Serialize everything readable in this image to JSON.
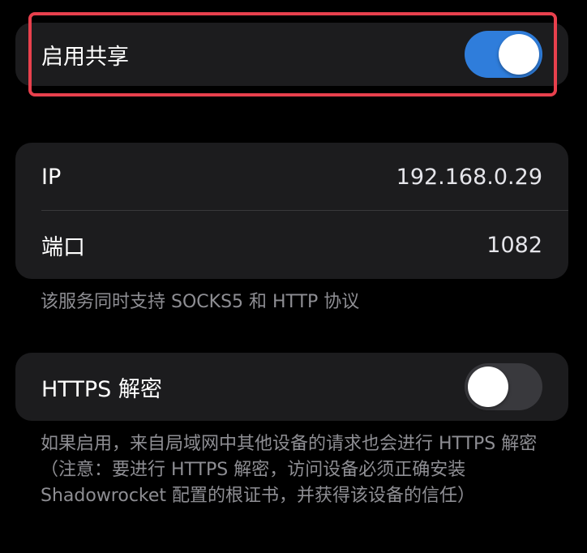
{
  "share": {
    "label": "启用共享",
    "enabled": true
  },
  "connection": {
    "ip_label": "IP",
    "ip_value": "192.168.0.29",
    "port_label": "端口",
    "port_value": "1082",
    "footnote": "该服务同时支持 SOCKS5 和 HTTP 协议"
  },
  "https": {
    "label": "HTTPS 解密",
    "enabled": false,
    "footnote": "如果启用，来自局域网中其他设备的请求也会进行 HTTPS 解密（注意：要进行 HTTPS 解密，访问设备必须正确安装 Shadowrocket 配置的根证书，并获得该设备的信任）"
  },
  "colors": {
    "toggle_on": "#2f7ddb",
    "toggle_off": "#39393d",
    "highlight": "#e8404d",
    "background": "#000000",
    "cell": "#1c1c1e",
    "secondary_text": "#8e8e93"
  }
}
